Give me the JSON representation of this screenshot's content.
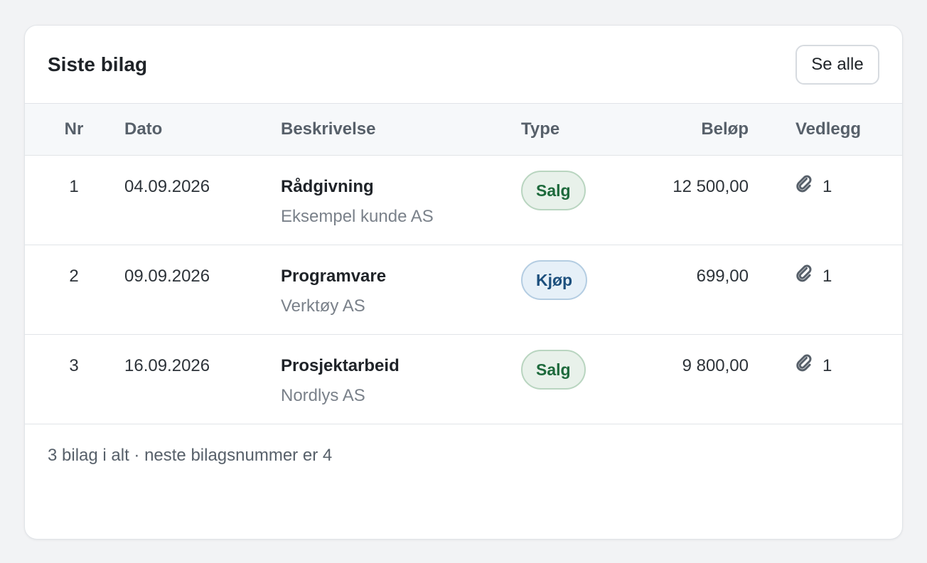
{
  "card": {
    "title": "Siste bilag",
    "see_all_label": "Se alle"
  },
  "table": {
    "headers": {
      "nr": "Nr",
      "date": "Dato",
      "description": "Beskrivelse",
      "type": "Type",
      "amount": "Beløp",
      "attachments": "Vedlegg"
    },
    "rows": [
      {
        "nr": "1",
        "date": "04.09.2026",
        "title": "Rådgivning",
        "subtitle": "Eksempel kunde AS",
        "type": "Salg",
        "amount": "12 500,00",
        "attachments": "1",
        "icon": "paperclip-icon"
      },
      {
        "nr": "2",
        "date": "09.09.2026",
        "title": "Programvare",
        "subtitle": "Verktøy AS",
        "type": "Kjøp",
        "amount": "699,00",
        "attachments": "1",
        "icon": "paperclip-icon"
      },
      {
        "nr": "3",
        "date": "16.09.2026",
        "title": "Prosjektarbeid",
        "subtitle": "Nordlys AS",
        "type": "Salg",
        "amount": "9 800,00",
        "attachments": "1",
        "icon": "paperclip-icon"
      }
    ]
  },
  "footer": {
    "summary": "3 bilag i alt · neste bilagsnummer er 4"
  },
  "colors": {
    "salg_text": "#1e6a3c",
    "salg_bg": "#e8f1ea",
    "kjop_text": "#1c4f7d",
    "kjop_bg": "#e6f0f8"
  }
}
